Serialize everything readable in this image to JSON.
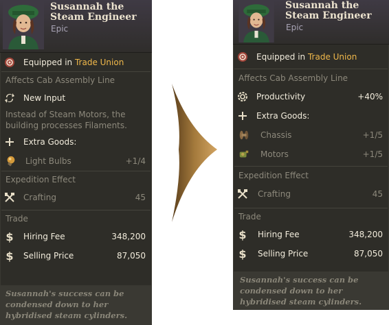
{
  "colors": {
    "panel_bg": "#2e2d28",
    "header_bg": "#3f3a44",
    "footer_bg": "#3a3933",
    "accent_gold": "#f0b84a",
    "text_bright": "#f2ecdc",
    "text_dim": "#8d897c",
    "arrow": "#a07a3a"
  },
  "before": {
    "name": "Susannah the Steam Engineer",
    "rarity": "Epic",
    "equipped_prefix": "Equipped in",
    "equipped_in": "Trade Union",
    "affects": "Affects Cab Assembly Line",
    "new_input_label": "New Input",
    "new_input_desc": "Instead of Steam Motors, the building processes Filaments.",
    "extra_goods_label": "Extra Goods:",
    "goods": [
      {
        "name": "Light Bulbs",
        "value": "+1/4",
        "icon": "light-bulb-icon"
      }
    ],
    "expedition_heading": "Expedition Effect",
    "expedition_name": "Crafting",
    "expedition_value": "45",
    "trade_heading": "Trade",
    "hiring_fee_label": "Hiring Fee",
    "hiring_fee": "348,200",
    "selling_price_label": "Selling Price",
    "selling_price": "87,050",
    "flavor": "Susannah's success can be condensed down to her hybridised steam cylinders."
  },
  "after": {
    "name": "Susannah the Steam Engineer",
    "rarity": "Epic",
    "equipped_prefix": "Equipped in",
    "equipped_in": "Trade Union",
    "affects": "Affects Cab Assembly Line",
    "productivity_label": "Productivity",
    "productivity_value": "+40%",
    "extra_goods_label": "Extra Goods:",
    "goods": [
      {
        "name": "Chassis",
        "value": "+1/5",
        "icon": "chassis-icon"
      },
      {
        "name": "Motors",
        "value": "+1/5",
        "icon": "motors-icon"
      }
    ],
    "expedition_heading": "Expedition Effect",
    "expedition_name": "Crafting",
    "expedition_value": "45",
    "trade_heading": "Trade",
    "hiring_fee_label": "Hiring Fee",
    "hiring_fee": "348,200",
    "selling_price_label": "Selling Price",
    "selling_price": "87,050",
    "flavor": "Susannah's success can be condensed down to her hybridised steam cylinders."
  }
}
